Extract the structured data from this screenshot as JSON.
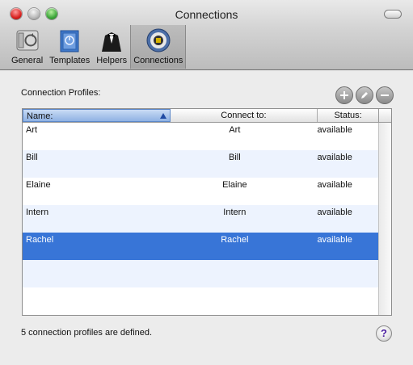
{
  "window": {
    "title": "Connections"
  },
  "toolbar": {
    "tabs": [
      {
        "label": "General",
        "icon": "general-icon"
      },
      {
        "label": "Templates",
        "icon": "templates-icon"
      },
      {
        "label": "Helpers",
        "icon": "helpers-icon"
      },
      {
        "label": "Connections",
        "icon": "connections-icon",
        "selected": true
      }
    ]
  },
  "main": {
    "section_label": "Connection Profiles:",
    "buttons": {
      "add": "plus-icon",
      "edit": "pencil-icon",
      "remove": "minus-icon"
    },
    "table": {
      "headers": [
        "Name:",
        "Connect to:",
        "Status:"
      ],
      "rows": [
        {
          "name": "Art",
          "connect": "Art",
          "status": "available"
        },
        {
          "name": "Bill",
          "connect": "Bill",
          "status": "available"
        },
        {
          "name": "Elaine",
          "connect": "Elaine",
          "status": "available"
        },
        {
          "name": "Intern",
          "connect": "Intern",
          "status": "available"
        },
        {
          "name": "Rachel",
          "connect": "Rachel",
          "status": "available",
          "selected": true
        }
      ]
    },
    "footer_text": "5 connection profiles are defined.",
    "help": "?"
  },
  "colors": {
    "selection": "#3875d7",
    "alt_row": "#edf3fe",
    "header_selected": "#8fb1e3"
  }
}
